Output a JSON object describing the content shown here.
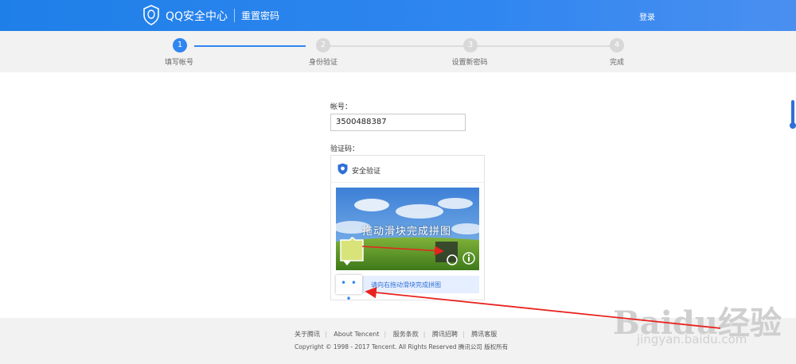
{
  "header": {
    "brand": "QQ安全中心",
    "page_name": "重置密码",
    "login": "登录"
  },
  "steps": [
    {
      "number": "1",
      "label": "填写帐号",
      "active": true
    },
    {
      "number": "2",
      "label": "身份验证",
      "active": false
    },
    {
      "number": "3",
      "label": "设置新密码",
      "active": false
    },
    {
      "number": "4",
      "label": "完成",
      "active": false
    }
  ],
  "form": {
    "account_label": "帐号：",
    "account_value": "3500488387",
    "captcha_label": "验证码："
  },
  "captcha": {
    "title": "安全验证",
    "puzzle_text": "拖动滑块完成拼图",
    "slider_hint": "请向右拖动滑块完成拼图",
    "handle_text": "• • •"
  },
  "footer": {
    "links": [
      "关于腾讯",
      "About Tencent",
      "服务条款",
      "腾讯招聘",
      "腾讯客服"
    ],
    "copyright": "Copyright © 1998 - 2017 Tencent. All Rights Reserved 腾讯公司 版权所有"
  },
  "watermark": {
    "main": "Baidu经验",
    "sub": "jingyan.baidu.com"
  },
  "colors": {
    "brand_blue": "#2f86f0",
    "annotation_red": "#e8231f"
  }
}
